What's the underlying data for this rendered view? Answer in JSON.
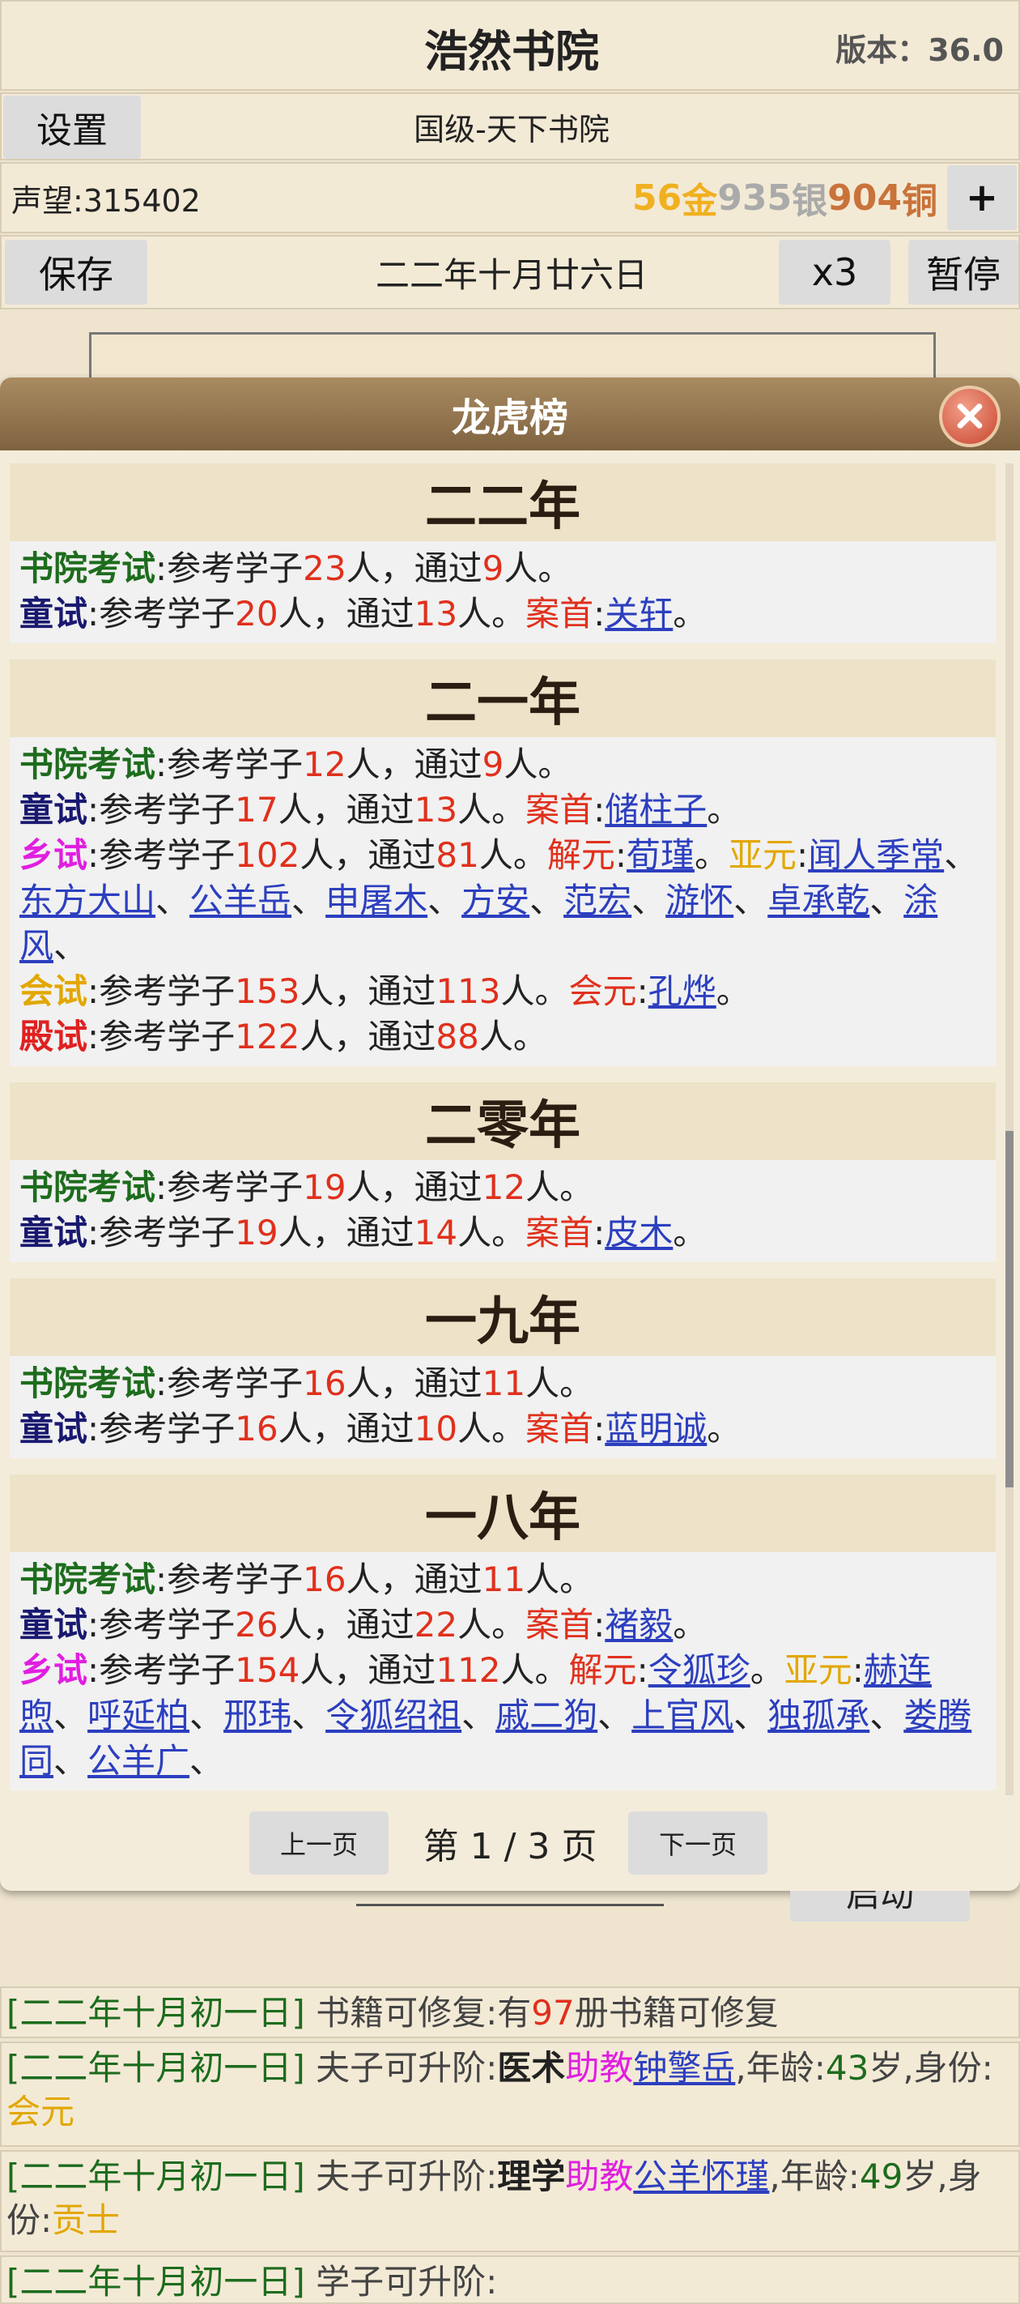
{
  "header": {
    "title": "浩然书院",
    "version": "版本：36.0"
  },
  "toolbar": {
    "settings_label": "设置",
    "rank": "国级-天下书院",
    "reputation": "声望:315402",
    "money": {
      "gold": "56",
      "gold_unit": "金",
      "silver": "935",
      "silver_unit": "银",
      "copper": "904",
      "copper_unit": "铜"
    },
    "add_label": "+",
    "save_label": "保存",
    "date": "二二年十月廿六日",
    "speed_label": "x3",
    "pause_label": "暂停"
  },
  "modal": {
    "title": "龙虎榜",
    "years": [
      {
        "title": "二二年",
        "lines": [
          {
            "k": "书院考试",
            "c": "k1",
            "a": "23",
            "b": "9"
          },
          {
            "k": "童试",
            "c": "k2",
            "a": "20",
            "b": "13",
            "first_label": "案首",
            "names": [
              "关轩"
            ]
          }
        ]
      },
      {
        "title": "二一年",
        "lines": [
          {
            "k": "书院考试",
            "c": "k1",
            "a": "12",
            "b": "9"
          },
          {
            "k": "童试",
            "c": "k2",
            "a": "17",
            "b": "13",
            "first_label": "案首",
            "names": [
              "储柱子"
            ]
          },
          {
            "k": "乡试",
            "c": "k3",
            "a": "102",
            "b": "81",
            "first_label": "解元",
            "names": [
              "荀瑾"
            ],
            "second_label": "亚元",
            "seconds": [
              "闻人季常",
              "东方大山",
              "公羊岳",
              "申屠木",
              "方安",
              "范宏",
              "游怀",
              "卓承乾",
              "涂风"
            ]
          },
          {
            "k": "会试",
            "c": "k4",
            "a": "153",
            "b": "113",
            "first_label": "会元",
            "names": [
              "孔烨"
            ]
          },
          {
            "k": "殿试",
            "c": "k5",
            "a": "122",
            "b": "88"
          }
        ]
      },
      {
        "title": "二零年",
        "lines": [
          {
            "k": "书院考试",
            "c": "k1",
            "a": "19",
            "b": "12"
          },
          {
            "k": "童试",
            "c": "k2",
            "a": "19",
            "b": "14",
            "first_label": "案首",
            "names": [
              "皮木"
            ]
          }
        ]
      },
      {
        "title": "一九年",
        "lines": [
          {
            "k": "书院考试",
            "c": "k1",
            "a": "16",
            "b": "11"
          },
          {
            "k": "童试",
            "c": "k2",
            "a": "16",
            "b": "10",
            "first_label": "案首",
            "names": [
              "蓝明诚"
            ]
          }
        ]
      },
      {
        "title": "一八年",
        "lines": [
          {
            "k": "书院考试",
            "c": "k1",
            "a": "16",
            "b": "11"
          },
          {
            "k": "童试",
            "c": "k2",
            "a": "26",
            "b": "22",
            "first_label": "案首",
            "names": [
              "褚毅"
            ]
          },
          {
            "k": "乡试",
            "c": "k3",
            "a": "154",
            "b": "112",
            "first_label": "解元",
            "names": [
              "令狐珍"
            ],
            "second_label": "亚元",
            "seconds": [
              "赫连煦",
              "呼延柏",
              "邢玮",
              "令狐绍祖",
              "戚二狗",
              "上官风",
              "独孤承",
              "娄腾同",
              "公羊广"
            ]
          }
        ]
      }
    ],
    "text": {
      "t1": ":参考学子",
      "t2": "人，通过",
      "t3": "人。",
      "sep": ":",
      "comma": "、",
      "period": "。"
    },
    "pager": {
      "prev": "上一页",
      "info": "第 1 / 3 页",
      "next": "下一页"
    }
  },
  "launch_label": "启动",
  "logs": [
    {
      "date": "[二二年十月初一日]",
      "pre": " 书籍可修复:有",
      "num": "97",
      "post": "册书籍可修复"
    },
    {
      "date": "[二二年十月初一日]",
      "pre": " 夫子可升阶:",
      "subject": "医术",
      "role": "助教",
      "name": "钟擎岳",
      "age_label": ",年龄:",
      "age": "43",
      "id_label": "岁,身份:",
      "identity": "会元"
    },
    {
      "date": "[二二年十月初一日]",
      "pre": " 夫子可升阶:",
      "subject": "理学",
      "role": "助教",
      "name": "公羊怀瑾",
      "age_label": ",年龄:",
      "age": "49",
      "id_label": "岁,身份:",
      "identity": "贡士"
    },
    {
      "date": "[二二年十月初一日]",
      "pre": " 学子可升阶:",
      "subject": "",
      "role": "",
      "name": "",
      "age_label": "",
      "age": "",
      "id_label": "",
      "identity": ""
    }
  ]
}
